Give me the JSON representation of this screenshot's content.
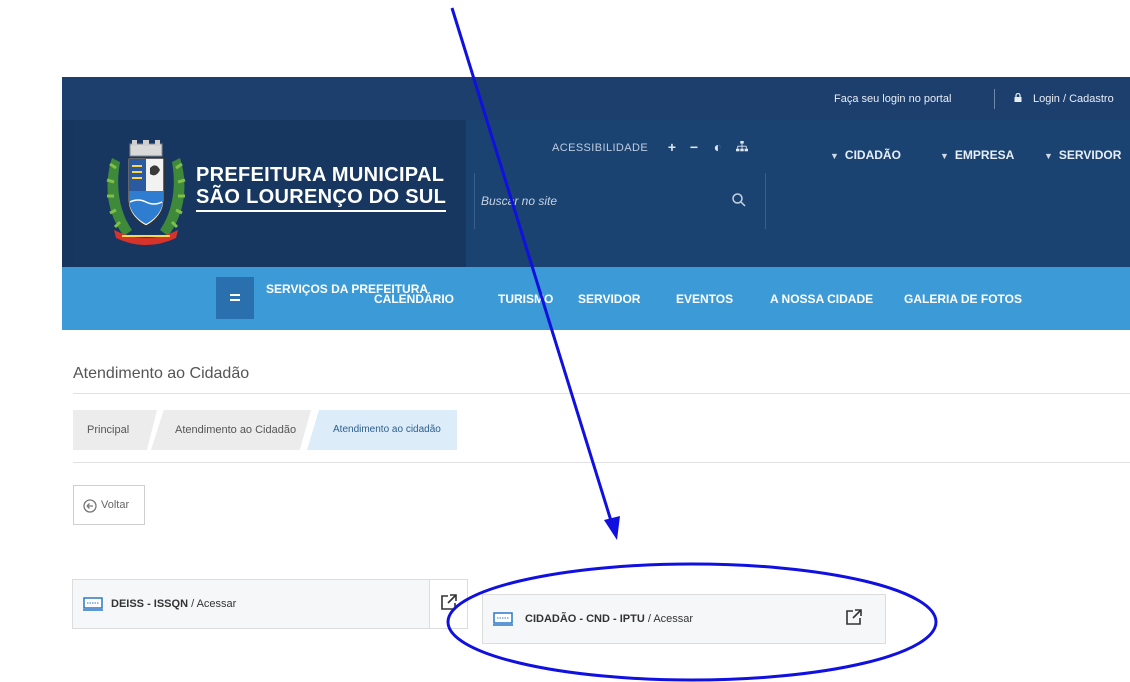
{
  "topbar": {
    "login_prompt": "Faça seu login no portal",
    "login_link": "Login / Cadastro"
  },
  "brand": {
    "line1": "PREFEITURA MUNICIPAL",
    "line2": "SÃO LOURENÇO DO SUL"
  },
  "accessibility": {
    "label": "ACESSIBILIDADE",
    "icons": [
      "plus-icon",
      "minus-icon",
      "contrast-icon",
      "sitemap-icon"
    ]
  },
  "search": {
    "placeholder": "Buscar no site"
  },
  "header_nav": {
    "cidadao": "CIDADÃO",
    "empresa": "EMPRESA",
    "servidor": "SERVIDOR"
  },
  "menu": {
    "servicos": "SERVIÇOS DA PREFEITURA",
    "calendario": "CALENDÁRIO",
    "turismo": "TURISMO",
    "servidor": "SERVIDOR",
    "eventos": "EVENTOS",
    "nossa_cidade": "A NOSSA CIDADE",
    "galeria": "GALERIA DE FOTOS"
  },
  "page": {
    "title": "Atendimento ao Cidadão",
    "back_label": "Voltar"
  },
  "breadcrumbs": [
    "Principal",
    "Atendimento ao Cidadão",
    "Atendimento ao cidadão"
  ],
  "cards": [
    {
      "title": "DEISS - ISSQN",
      "action": " / Acessar"
    },
    {
      "title": "CIDADÃO - CND - IPTU",
      "action": " / Acessar"
    }
  ],
  "colors": {
    "topbar": "#1d3f6e",
    "header": "#17365f",
    "menubar": "#3c9ad6",
    "annotation": "#1010e0"
  }
}
